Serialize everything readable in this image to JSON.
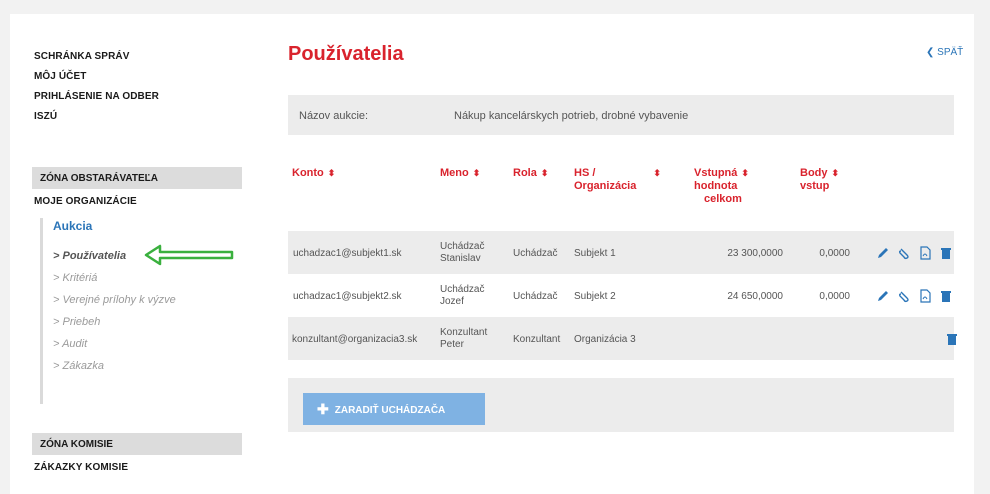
{
  "sidebar": {
    "nav": [
      "SCHRÁNKA SPRÁV",
      "MÔJ ÚČET",
      "PRIHLÁSENIE NA ODBER",
      "ISZÚ"
    ],
    "zone1": "ZÓNA OBSTARÁVATEĽA",
    "my_orgs": "MOJE ORGANIZÁCIE",
    "sub_head": "Aukcia",
    "sub_items": [
      "> Používatelia",
      "> Kritériá",
      "> Verejné prílohy k výzve",
      "> Priebeh",
      "> Audit",
      "> Zákazka"
    ],
    "zone2": "ZÓNA KOMISIE",
    "commission": "ZÁKAZKY KOMISIE"
  },
  "main": {
    "title": "Používatelia",
    "back": "SPÄŤ",
    "auction_label": "Názov aukcie:",
    "auction_value": "Nákup kancelárskych potrieb, drobné vybavenie"
  },
  "table": {
    "headers": {
      "konto": "Konto",
      "meno": "Meno",
      "rola": "Rola",
      "hs1": "HS /",
      "hs2": "Organizácia",
      "vh1": "Vstupná",
      "vh2": "hodnota",
      "vh3": "celkom",
      "body1": "Body",
      "body2": "vstup",
      "sort_glyph": "⬍"
    },
    "rows": [
      {
        "konto": "uchadzac1@subjekt1.sk",
        "meno1": "Uchádzač",
        "meno2": "Stanislav",
        "rola": "Uchádzač",
        "org": "Subjekt 1",
        "value": "23 300,0000",
        "body": "0,0000"
      },
      {
        "konto": "uchadzac1@subjekt2.sk",
        "meno1": "Uchádzač",
        "meno2": "Jozef",
        "rola": "Uchádzač",
        "org": "Subjekt 2",
        "value": "24 650,0000",
        "body": "0,0000"
      },
      {
        "konto": "konzultant@organizacia3.sk",
        "meno1": "Konzultant",
        "meno2": "Peter",
        "rola": "Konzultant",
        "org": "Organizácia 3",
        "value": "",
        "body": ""
      }
    ]
  },
  "add_button": "ZARADIŤ UCHÁDZAČA",
  "colors": {
    "accent_red": "#d9232d",
    "link_blue": "#2b75b8",
    "button_blue": "#7fb2e3",
    "arrow_green": "#3ab03e"
  }
}
